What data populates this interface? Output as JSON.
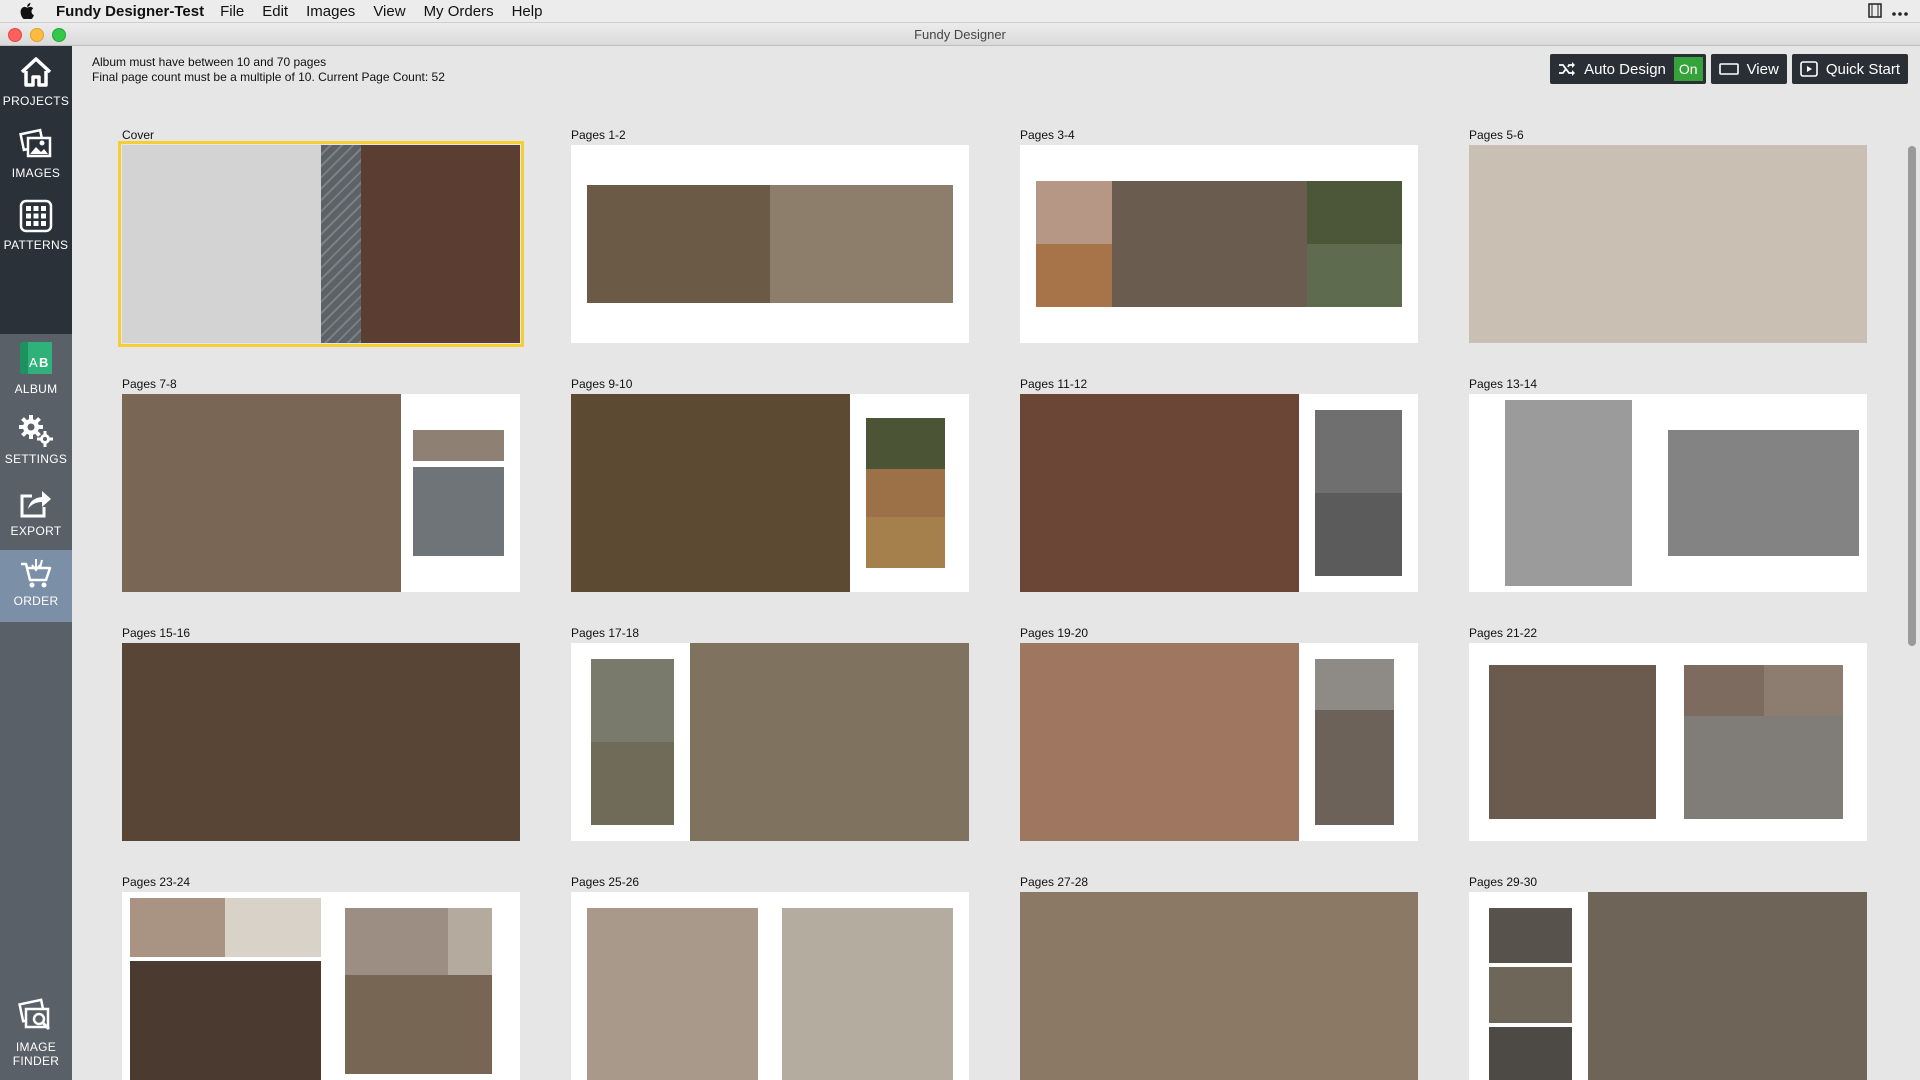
{
  "menubar": {
    "app_name": "Fundy Designer-Test",
    "items": [
      "File",
      "Edit",
      "Images",
      "View",
      "My Orders",
      "Help"
    ]
  },
  "window": {
    "title": "Fundy Designer"
  },
  "sidebar": {
    "items": [
      {
        "label": "PROJECTS",
        "icon": "home-icon"
      },
      {
        "label": "IMAGES",
        "icon": "images-icon"
      },
      {
        "label": "PATTERNS",
        "icon": "patterns-grid-icon"
      },
      {
        "label": "ALBUM",
        "icon": "album-ab-icon"
      },
      {
        "label": "SETTINGS",
        "icon": "gears-icon"
      },
      {
        "label": "EXPORT",
        "icon": "export-icon"
      },
      {
        "label": "ORDER",
        "icon": "cart-icon"
      },
      {
        "label": "IMAGE\nFINDER",
        "icon": "image-finder-icon"
      }
    ]
  },
  "info": {
    "line1": "Album must have between 10 and 70 pages",
    "line2": "Final page count must be a multiple of 10. Current Page Count: 52"
  },
  "toolbar": {
    "auto_design": "Auto Design",
    "auto_design_state": "On",
    "view": "View",
    "quick_start": "Quick Start"
  },
  "spreads": [
    "Cover",
    "Pages 1-2",
    "Pages 3-4",
    "Pages 5-6",
    "Pages 7-8",
    "Pages 9-10",
    "Pages 11-12",
    "Pages 13-14",
    "Pages 15-16",
    "Pages 17-18",
    "Pages 19-20",
    "Pages 21-22",
    "Pages 23-24",
    "Pages 25-26",
    "Pages 27-28",
    "Pages 29-30"
  ],
  "colors": {
    "accent_on": "#35a33a",
    "selection": "#f4cf33",
    "sidebar_dark": "#2a3139",
    "sidebar_active": "#7b8fa6"
  }
}
